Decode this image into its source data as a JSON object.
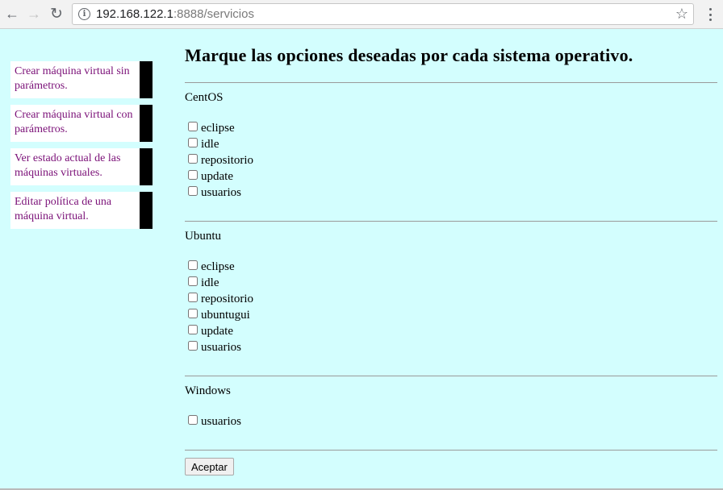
{
  "browser": {
    "url_host": "192.168.122.1",
    "url_rest": ":8888/servicios"
  },
  "sidebar": {
    "items": [
      {
        "label": "Crear máquina virtual sin parámetros."
      },
      {
        "label": "Crear máquina virtual con parámetros."
      },
      {
        "label": "Ver estado actual de las máquinas virtuales."
      },
      {
        "label": "Editar política de una máquina virtual."
      }
    ]
  },
  "main": {
    "title": "Marque las opciones deseadas por cada sistema operativo.",
    "sections": [
      {
        "name": "CentOS",
        "options": [
          "eclipse",
          "idle",
          "repositorio",
          "update",
          "usuarios"
        ]
      },
      {
        "name": "Ubuntu",
        "options": [
          "eclipse",
          "idle",
          "repositorio",
          "ubuntugui",
          "update",
          "usuarios"
        ]
      },
      {
        "name": "Windows",
        "options": [
          "usuarios"
        ]
      }
    ],
    "submit_label": "Aceptar"
  },
  "icons": {
    "back": "back-arrow-icon",
    "forward": "forward-arrow-icon",
    "reload": "reload-icon",
    "info": "info-icon",
    "bookmark": "star-icon",
    "menu": "kebab-menu-icon"
  }
}
